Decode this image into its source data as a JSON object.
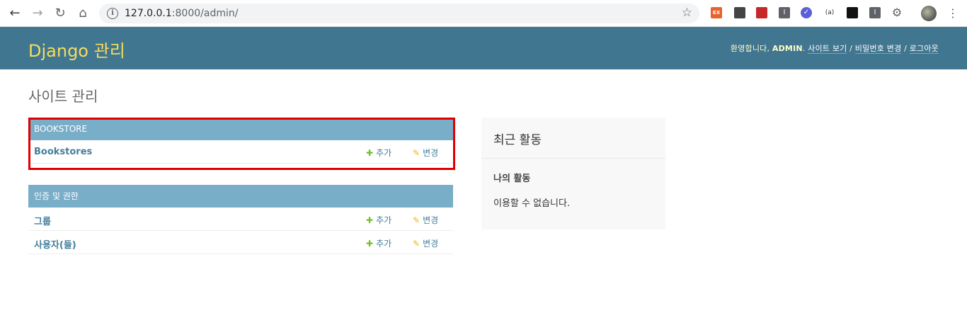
{
  "browser": {
    "url_host": "127.0.0.1",
    "url_rest": ":8000/admin/"
  },
  "header": {
    "branding": "Django 관리",
    "welcome": "환영합니다, ",
    "username": "ADMIN",
    "view_site": "사이트 보기",
    "change_password": "비밀번호 변경",
    "logout": "로그아웃",
    "separator": " / "
  },
  "page_title": "사이트 관리",
  "modules": [
    {
      "caption": "BOOKSTORE",
      "rows": [
        {
          "model": "Bookstores",
          "add": "추가",
          "change": "변경"
        }
      ]
    },
    {
      "caption": "인증 및 권한",
      "rows": [
        {
          "model": "그룹",
          "add": "추가",
          "change": "변경"
        },
        {
          "model": "사용자(들)",
          "add": "추가",
          "change": "변경"
        }
      ]
    }
  ],
  "recent_actions": {
    "title": "최근 활동",
    "subtitle": "나의 활동",
    "empty": "이용할 수 없습니다."
  },
  "colors": {
    "header_bg": "#417690",
    "branding": "#f5dd5d",
    "module_caption_bg": "#79aec8",
    "link": "#447e9b",
    "add_icon": "#70bf2b",
    "change_icon": "#efb80b",
    "highlight_border": "#e00000"
  },
  "icons": {
    "add": "plus-icon",
    "change": "pencil-icon"
  }
}
